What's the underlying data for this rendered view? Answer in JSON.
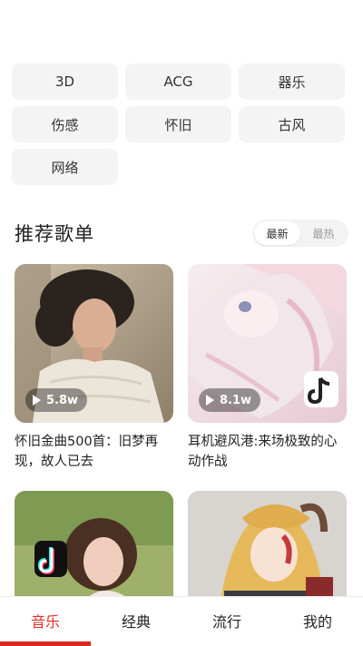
{
  "tags": [
    "3D",
    "ACG",
    "器乐",
    "伤感",
    "怀旧",
    "古风",
    "网络"
  ],
  "section": {
    "title": "推荐歌单",
    "sort_latest": "最新",
    "sort_hottest": "最热"
  },
  "playlists": [
    {
      "play_count": "5.8w",
      "title": "怀旧金曲500首：旧梦再现，故人已去"
    },
    {
      "play_count": "8.1w",
      "title": "耳机避风港:来场极致的心动作战"
    },
    {
      "play_count": "",
      "title": ""
    },
    {
      "play_count": "",
      "title": ""
    }
  ],
  "tabs": [
    "音乐",
    "经典",
    "流行",
    "我的"
  ],
  "colors": {
    "accent": "#e3312b",
    "tag_bg": "#f4f4f4"
  }
}
